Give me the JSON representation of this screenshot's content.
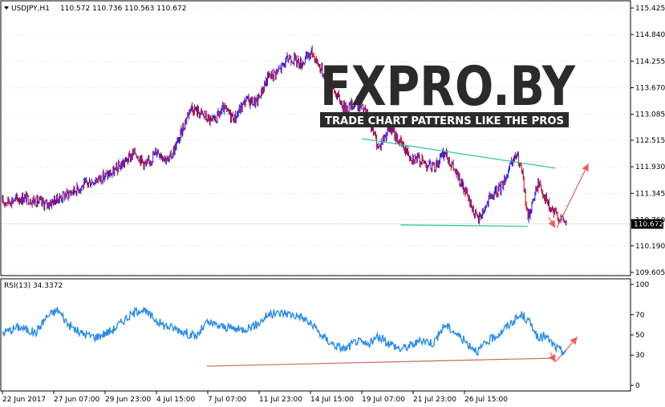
{
  "header": {
    "symbol": "USDJPY,H1",
    "ohlc": "110.572 110.736 110.563 110.672"
  },
  "logo": {
    "brand": "FXPRO.BY",
    "tagline": "TRADE CHART PATTERNS LIKE THE PROS"
  },
  "colors": {
    "background": "#ffffff",
    "grid": "#c8c8c8",
    "candle_up": "#1e1eff",
    "candle_down": "#d40000",
    "rsi_line": "#2a8ce8",
    "channel_line": "#2ec4a8",
    "rsi_support": "#c96a5a",
    "projection": "#f25c5c"
  },
  "chart_data": [
    {
      "type": "candlestick",
      "title": "USDJPY,H1",
      "ylim": [
        109.605,
        115.425
      ],
      "y_ticks": [
        "115.425",
        "114.840",
        "114.255",
        "113.670",
        "113.085",
        "112.515",
        "111.930",
        "111.345",
        "110.760",
        "110.190",
        "109.605"
      ],
      "current_price": "110.672",
      "x_ticks": [
        "22 Jun 2017",
        "27 Jun 07:00",
        "29 Jun 23:00",
        "4 Jul 15:00",
        "7 Jul 07:00",
        "11 Jul 23:00",
        "14 Jul 15:00",
        "19 Jul 07:00",
        "21 Jul 23:00",
        "26 Jul 15:00"
      ],
      "approx_path": [
        [
          0,
          111.15
        ],
        [
          4,
          111.25
        ],
        [
          8,
          111.1
        ],
        [
          12,
          111.35
        ],
        [
          16,
          111.6
        ],
        [
          20,
          111.8
        ],
        [
          24,
          112.25
        ],
        [
          26,
          111.95
        ],
        [
          28,
          112.3
        ],
        [
          30,
          112.05
        ],
        [
          32,
          112.55
        ],
        [
          34,
          113.25
        ],
        [
          36,
          113.1
        ],
        [
          38,
          112.9
        ],
        [
          40,
          113.2
        ],
        [
          42,
          113.0
        ],
        [
          44,
          113.4
        ],
        [
          46,
          113.35
        ],
        [
          48,
          113.9
        ],
        [
          50,
          114.05
        ],
        [
          52,
          114.35
        ],
        [
          54,
          114.2
        ],
        [
          56,
          114.45
        ],
        [
          58,
          114.0
        ],
        [
          60,
          113.6
        ],
        [
          62,
          113.2
        ],
        [
          64,
          113.35
        ],
        [
          66,
          113.1
        ],
        [
          68,
          112.35
        ],
        [
          70,
          112.8
        ],
        [
          72,
          112.45
        ],
        [
          74,
          112.15
        ],
        [
          76,
          112.05
        ],
        [
          78,
          111.9
        ],
        [
          80,
          112.25
        ],
        [
          82,
          111.8
        ],
        [
          84,
          111.3
        ],
        [
          86,
          110.75
        ],
        [
          88,
          111.2
        ],
        [
          90,
          111.45
        ],
        [
          92,
          111.95
        ],
        [
          93,
          112.2
        ],
        [
          94,
          111.8
        ],
        [
          95,
          110.8
        ],
        [
          97,
          111.6
        ],
        [
          99,
          111.0
        ],
        [
          101,
          110.8
        ],
        [
          102,
          110.7
        ]
      ],
      "annotations": {
        "resistance_line": [
          [
            65,
            112.55
          ],
          [
            100,
            111.9
          ]
        ],
        "support_line": [
          [
            72,
            110.65
          ],
          [
            95,
            110.62
          ]
        ],
        "projection": [
          [
            100,
            110.57
          ],
          [
            106,
            112.0
          ]
        ]
      }
    },
    {
      "type": "line",
      "title": "RSI(13) 34.3372",
      "ylim": [
        0,
        100
      ],
      "y_ticks": [
        "100",
        "70",
        "50",
        "30",
        "0"
      ],
      "approx_path": [
        [
          0,
          52
        ],
        [
          3,
          58
        ],
        [
          6,
          52
        ],
        [
          8,
          68
        ],
        [
          10,
          75
        ],
        [
          12,
          60
        ],
        [
          14,
          52
        ],
        [
          17,
          48
        ],
        [
          20,
          55
        ],
        [
          22,
          65
        ],
        [
          25,
          76
        ],
        [
          27,
          68
        ],
        [
          29,
          60
        ],
        [
          32,
          55
        ],
        [
          35,
          48
        ],
        [
          37,
          62
        ],
        [
          40,
          58
        ],
        [
          43,
          55
        ],
        [
          46,
          60
        ],
        [
          48,
          70
        ],
        [
          51,
          72
        ],
        [
          54,
          68
        ],
        [
          56,
          60
        ],
        [
          58,
          48
        ],
        [
          60,
          40
        ],
        [
          62,
          36
        ],
        [
          64,
          44
        ],
        [
          66,
          40
        ],
        [
          68,
          48
        ],
        [
          70,
          42
        ],
        [
          72,
          36
        ],
        [
          74,
          40
        ],
        [
          76,
          45
        ],
        [
          78,
          42
        ],
        [
          80,
          60
        ],
        [
          82,
          52
        ],
        [
          84,
          42
        ],
        [
          86,
          34
        ],
        [
          88,
          44
        ],
        [
          90,
          52
        ],
        [
          92,
          62
        ],
        [
          94,
          70
        ],
        [
          96,
          58
        ],
        [
          97,
          44
        ],
        [
          98,
          50
        ],
        [
          100,
          38
        ],
        [
          101,
          34
        ],
        [
          102,
          34
        ]
      ],
      "annotations": {
        "support_line": [
          [
            37,
            19
          ],
          [
            100,
            27
          ]
        ],
        "projection": [
          [
            100,
            23
          ],
          [
            104,
            48
          ]
        ]
      }
    }
  ]
}
